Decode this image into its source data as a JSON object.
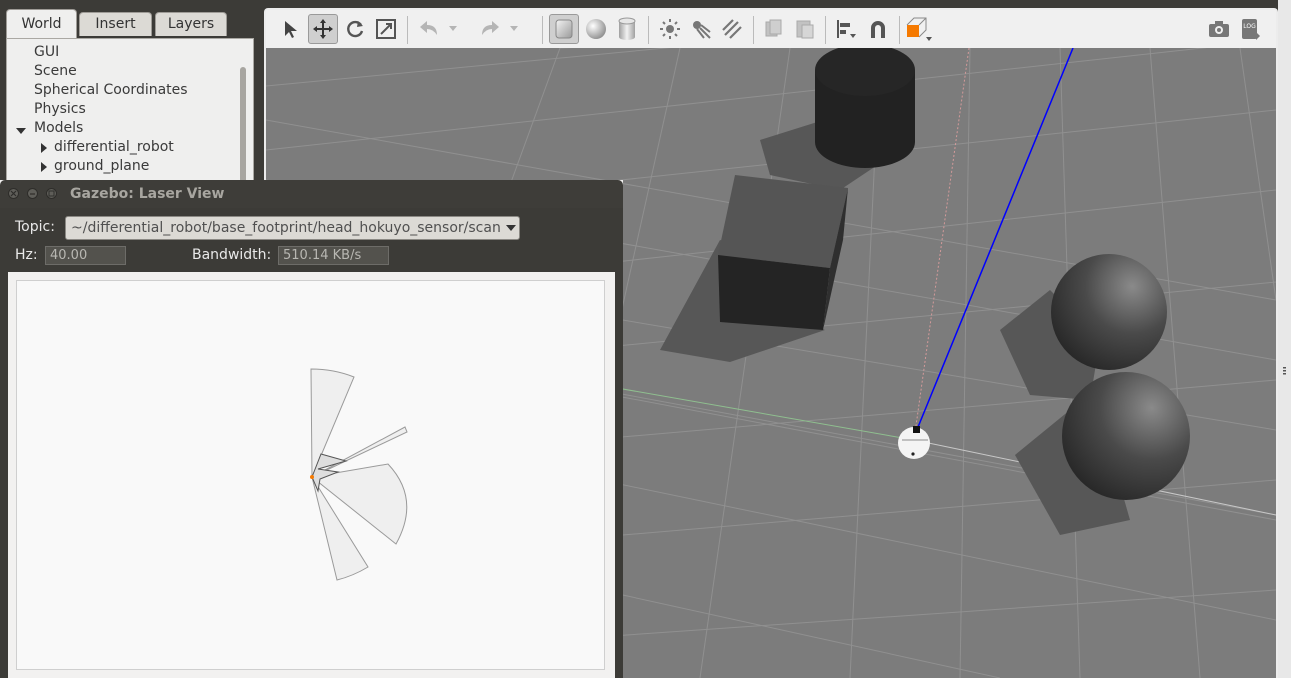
{
  "panel_tabs": [
    {
      "label": "World",
      "active": true
    },
    {
      "label": "Insert",
      "active": false
    },
    {
      "label": "Layers",
      "active": false
    }
  ],
  "world_tree": {
    "items": [
      {
        "label": "GUI"
      },
      {
        "label": "Scene"
      },
      {
        "label": "Spherical Coordinates"
      },
      {
        "label": "Physics"
      },
      {
        "label": "Models",
        "expanded": true
      },
      {
        "label": "differential_robot",
        "expanded": false
      },
      {
        "label": "ground_plane",
        "expanded": false
      }
    ]
  },
  "toolbar": {
    "tools": [
      "select-arrow-icon",
      "translate-icon",
      "rotate-icon",
      "scale-icon",
      "undo-icon",
      "undo-dropdown-icon",
      "redo-icon",
      "redo-dropdown-icon",
      "box-icon",
      "sphere-icon",
      "cylinder-icon",
      "point-light-icon",
      "spot-light-icon",
      "directional-light-icon",
      "copy-icon",
      "paste-icon",
      "align-icon",
      "snap-magnet-icon",
      "view-angle-icon",
      "screenshot-icon",
      "log-icon"
    ],
    "log_text": "LOG"
  },
  "laser_view": {
    "title": "Gazebo: Laser View",
    "topic_label": "Topic:",
    "topic_value": "~/differential_robot/base_footprint/head_hokuyo_sensor/scan",
    "hz_label": "Hz:",
    "hz_value": "40.00",
    "bandwidth_label": "Bandwidth:",
    "bandwidth_value": "510.14 KB/s"
  },
  "colors": {
    "accent_orange": "#f57900",
    "laser_ray_blue": "#0000ff",
    "ground_gray": "#7c7c7c",
    "window_dark": "#3c3b37"
  }
}
